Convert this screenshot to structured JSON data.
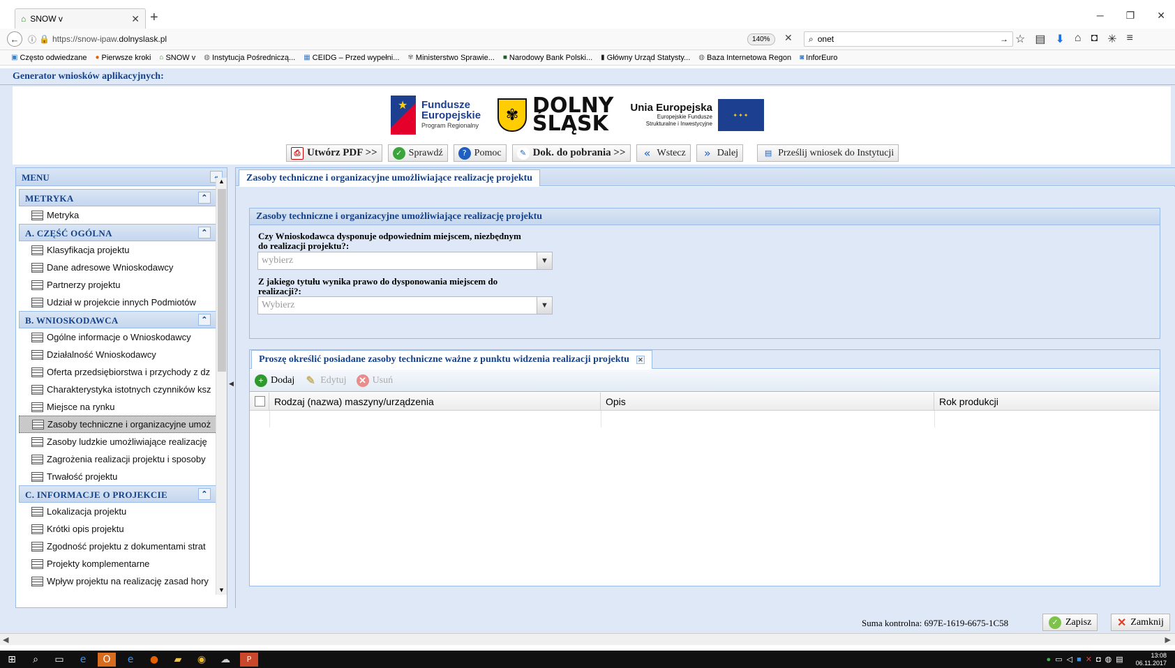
{
  "browser": {
    "tab_title": "SNOW v",
    "url_prefix": "https://snow-ipaw.",
    "url_domain": "dolnyslask.pl",
    "zoom": "140%",
    "search_value": "onet",
    "bookmarks": [
      "Często odwiedzane",
      "Pierwsze kroki",
      "SNOW v",
      "Instytucja Pośredniczą...",
      "CEIDG – Przed wypełni...",
      "Ministerstwo Sprawie...",
      "Narodowy Bank Polski...",
      "Główny Urząd Statysty...",
      "Baza Internetowa Regon",
      "InforEuro"
    ]
  },
  "app": {
    "title": "Generator wniosków aplikacyjnych:",
    "logos": {
      "fe_line1": "Fundusze",
      "fe_line2": "Europejskie",
      "fe_line3": "Program Regionalny",
      "ds_line1": "DOLNY",
      "ds_line2": "ŚLĄSK",
      "ue_line1": "Unia Europejska",
      "ue_line2": "Europejskie Fundusze",
      "ue_line3": "Strukturalne i Inwestycyjne"
    },
    "toolbar": {
      "pdf": "Utwórz PDF >>",
      "check": "Sprawdź",
      "help": "Pomoc",
      "docs": "Dok. do pobrania >>",
      "back": "Wstecz",
      "next": "Dalej",
      "send": "Prześlij wniosek do Instytucji"
    }
  },
  "menu": {
    "title": "MENU",
    "sections": [
      {
        "label": "METRYKA",
        "items": [
          "Metryka"
        ]
      },
      {
        "label": "A. CZĘŚĆ OGÓLNA",
        "items": [
          "Klasyfikacja projektu",
          "Dane adresowe Wnioskodawcy",
          "Partnerzy projektu",
          "Udział w projekcie innych Podmiotów"
        ]
      },
      {
        "label": "B. WNIOSKODAWCA",
        "items": [
          "Ogólne informacje o Wnioskodawcy",
          "Działalność Wnioskodawcy",
          "Oferta przedsiębiorstwa i przychody z dz",
          "Charakterystyka istotnych czynników ksz",
          "Miejsce na rynku",
          "Zasoby techniczne i organizacyjne umoż",
          "Zasoby ludzkie umożliwiające realizację",
          "Zagrożenia realizacji projektu i sposoby",
          "Trwałość projektu"
        ]
      },
      {
        "label": "C. INFORMACJE O PROJEKCIE",
        "items": [
          "Lokalizacja projektu",
          "Krótki opis projektu",
          "Zgodność projektu z dokumentami strat",
          "Projekty komplementarne",
          "Wpływ projektu na realizację zasad hory"
        ]
      }
    ],
    "selected": "Zasoby techniczne i organizacyjne umoż"
  },
  "main": {
    "tab_label": "Zasoby techniczne i organizacyjne umożliwiające realizację projektu",
    "fieldset_title": "Zasoby techniczne i organizacyjne umożliwiające realizację projektu",
    "q1_line1": "Czy Wnioskodawca dysponuje odpowiednim miejscem, niezbędnym",
    "q1_line2": "do realizacji projektu?:",
    "q1_value": "wybierz",
    "q2_line1": "Z jakiego tytułu wynika prawo do dysponowania miejscem do",
    "q2_line2": "realizacji?:",
    "q2_value": "Wybierz",
    "grid": {
      "title": "Proszę określić posiadane zasoby techniczne ważne z punktu widzenia realizacji projektu",
      "add": "Dodaj",
      "edit": "Edytuj",
      "delete": "Usuń",
      "columns": [
        "Rodzaj (nazwa) maszyny/urządzenia",
        "Opis",
        "Rok produkcji"
      ]
    }
  },
  "footer": {
    "checksum": "Suma kontrolna: 697E-1619-6675-1C58",
    "save": "Zapisz",
    "close": "Zamknij"
  },
  "clock": {
    "time": "13:08",
    "date": "06.11.2017"
  },
  "colors": {
    "panel_bg": "#dfe8f6",
    "header_text": "#15428b",
    "border": "#99bbe8"
  }
}
